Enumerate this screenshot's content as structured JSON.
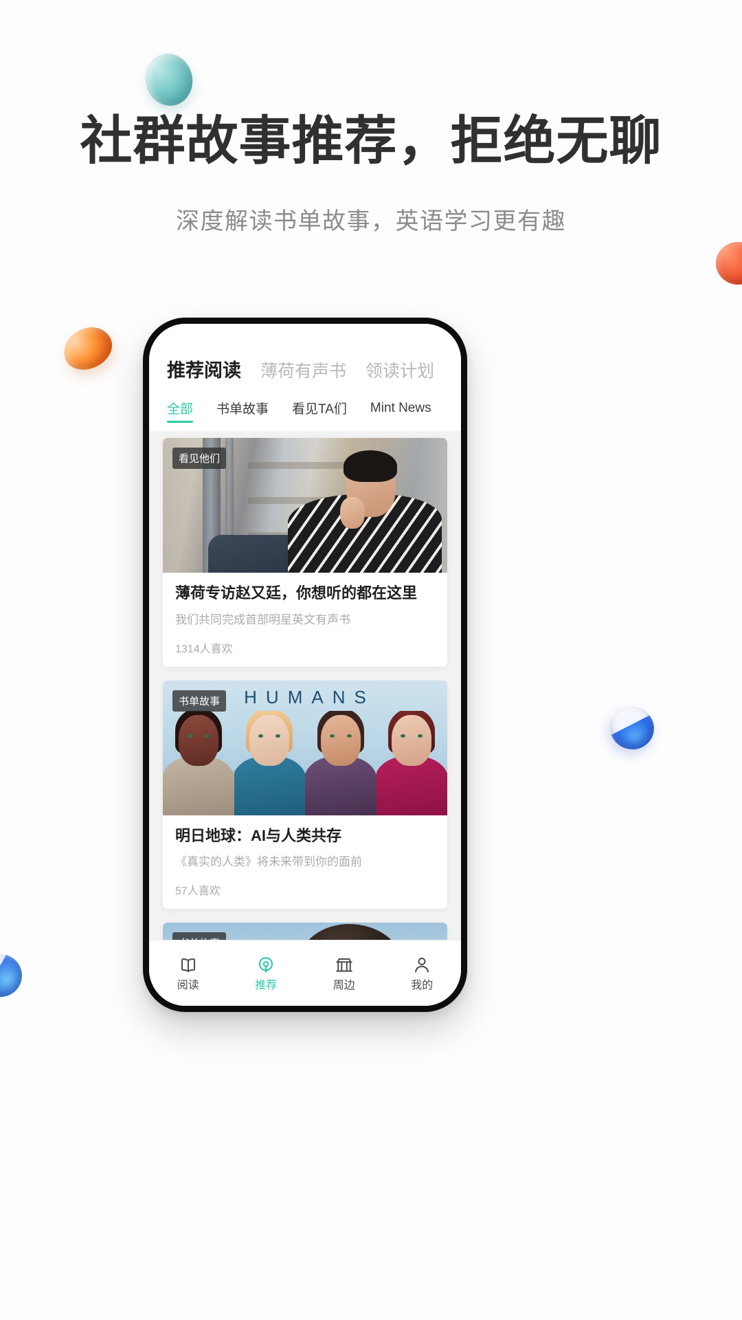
{
  "hero": {
    "title": "社群故事推荐，拒绝无聊",
    "subtitle": "深度解读书单故事，英语学习更有趣"
  },
  "decor": {
    "teal_blob": "teal-sphere",
    "orange_blob_right": "orange-sphere",
    "orange_blob_left": "orange-pebble",
    "blue_blob_right": "blue-white-sphere",
    "blue_blob_bottom_left": "blue-white-sphere"
  },
  "colors": {
    "accent": "#2ec9ab",
    "title": "#1f2022",
    "muted": "#a9abad",
    "badge_bg": "#303030"
  },
  "app": {
    "main_tabs": [
      {
        "label": "推荐阅读",
        "active": true
      },
      {
        "label": "薄荷有声书",
        "active": false
      },
      {
        "label": "领读计划",
        "active": false
      }
    ],
    "sub_tabs": [
      {
        "label": "全部",
        "active": true
      },
      {
        "label": "书单故事",
        "active": false
      },
      {
        "label": "看见TA们",
        "active": false
      },
      {
        "label": "Mint News",
        "active": false
      }
    ],
    "cards": [
      {
        "badge": "看见他们",
        "title": "薄荷专访赵又廷，你想听的都在这里",
        "subtitle": "我们共同完成首部明星英文有声书",
        "likes": "1314人喜欢",
        "image": "interview-photo"
      },
      {
        "badge": "书单故事",
        "poster_text": "HUMANS",
        "title": "明日地球：AI与人类共存",
        "subtitle": "《真实的人类》将未来带到你的面前",
        "likes": "57人喜欢",
        "image": "humans-poster"
      },
      {
        "badge": "书单故事",
        "title": "",
        "subtitle": "",
        "likes": "",
        "image": "sky-portrait-photo"
      }
    ],
    "bottom_nav": [
      {
        "label": "阅读",
        "icon": "book-icon",
        "active": false
      },
      {
        "label": "推荐",
        "icon": "compass-target-icon",
        "active": true
      },
      {
        "label": "周边",
        "icon": "store-icon",
        "active": false
      },
      {
        "label": "我的",
        "icon": "person-icon",
        "active": false
      }
    ]
  }
}
